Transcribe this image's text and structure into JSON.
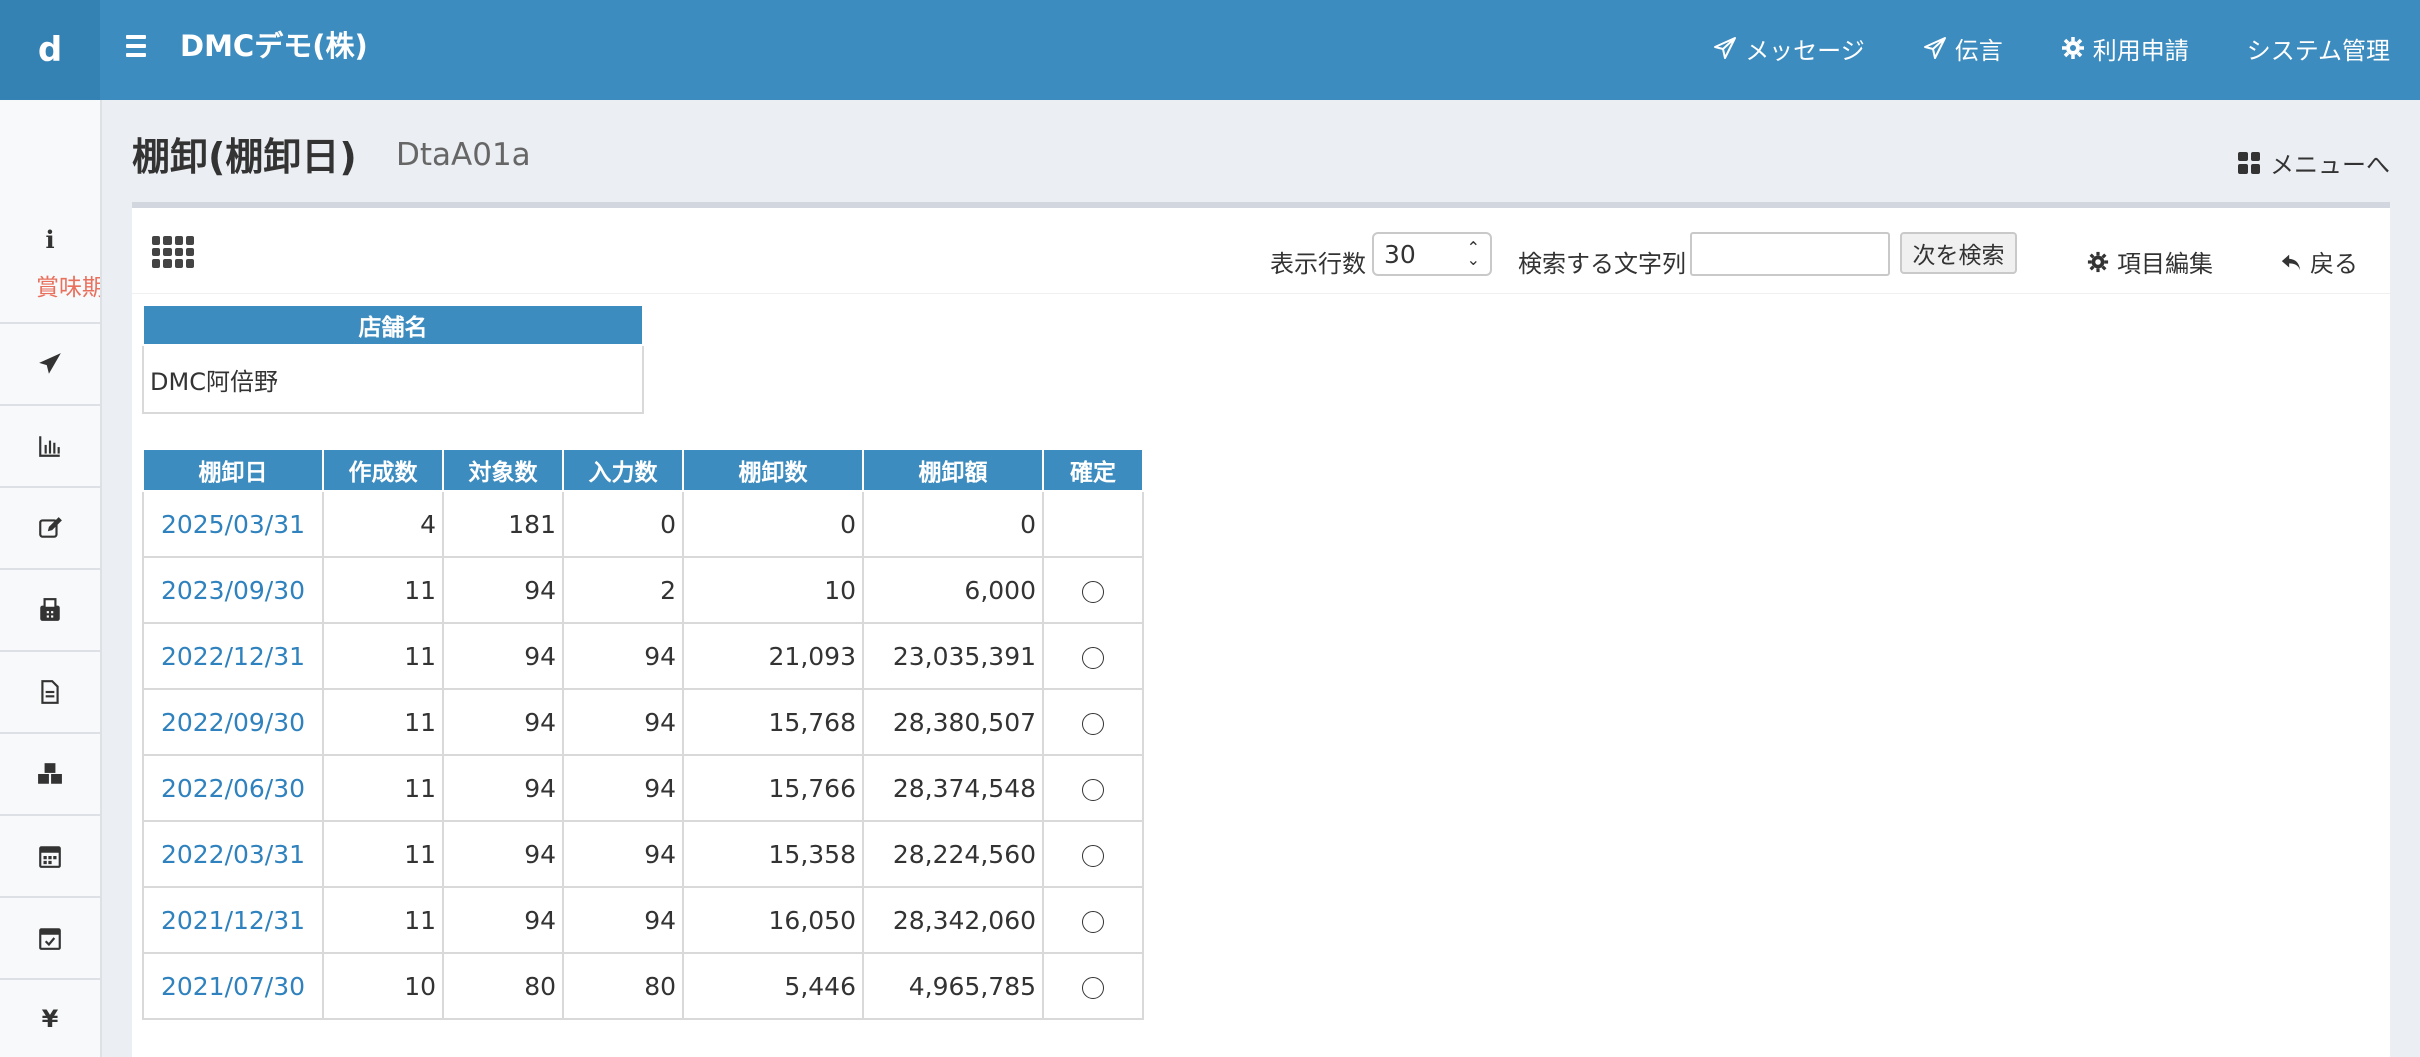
{
  "header": {
    "logo": "d",
    "company": "DMCデモ(株)",
    "nav": [
      {
        "label": "メッセージ",
        "icon": "paper-plane-icon"
      },
      {
        "label": "伝言",
        "icon": "paper-plane-icon"
      },
      {
        "label": "利用申請",
        "icon": "gear-icon"
      },
      {
        "label": "システム管理",
        "icon": ""
      }
    ]
  },
  "sidebar": {
    "info_glyph": "i",
    "notice": "賞味期",
    "items": [
      {
        "icon": "paper-plane-icon"
      },
      {
        "icon": "bar-chart-icon"
      },
      {
        "icon": "edit-icon"
      },
      {
        "icon": "fax-icon"
      },
      {
        "icon": "document-icon"
      },
      {
        "icon": "cubes-icon"
      },
      {
        "icon": "calendar-icon"
      },
      {
        "icon": "calendar-check-icon"
      },
      {
        "icon": "yen-icon",
        "glyph": "¥"
      }
    ]
  },
  "page": {
    "title": "棚卸(棚卸日)",
    "code": "DtaA01a",
    "menu_link": "メニューへ"
  },
  "toolbar": {
    "rows_label": "表示行数",
    "rows_value": "30",
    "search_label": "検索する文字列",
    "search_value": "",
    "next_button": "次を検索",
    "edit_items": "項目編集",
    "back": "戻る"
  },
  "store": {
    "header": "店舗名",
    "value": "DMC阿倍野"
  },
  "inventory": {
    "columns": [
      "棚卸日",
      "作成数",
      "対象数",
      "入力数",
      "棚卸数",
      "棚卸額",
      "確定"
    ],
    "rows": [
      {
        "date": "2025/03/31",
        "created": "4",
        "target": "181",
        "input": "0",
        "count": "0",
        "amount": "0",
        "confirmed": false
      },
      {
        "date": "2023/09/30",
        "created": "11",
        "target": "94",
        "input": "2",
        "count": "10",
        "amount": "6,000",
        "confirmed": true
      },
      {
        "date": "2022/12/31",
        "created": "11",
        "target": "94",
        "input": "94",
        "count": "21,093",
        "amount": "23,035,391",
        "confirmed": true
      },
      {
        "date": "2022/09/30",
        "created": "11",
        "target": "94",
        "input": "94",
        "count": "15,768",
        "amount": "28,380,507",
        "confirmed": true
      },
      {
        "date": "2022/06/30",
        "created": "11",
        "target": "94",
        "input": "94",
        "count": "15,766",
        "amount": "28,374,548",
        "confirmed": true
      },
      {
        "date": "2022/03/31",
        "created": "11",
        "target": "94",
        "input": "94",
        "count": "15,358",
        "amount": "28,224,560",
        "confirmed": true
      },
      {
        "date": "2021/12/31",
        "created": "11",
        "target": "94",
        "input": "94",
        "count": "16,050",
        "amount": "28,342,060",
        "confirmed": true
      },
      {
        "date": "2021/07/30",
        "created": "10",
        "target": "80",
        "input": "80",
        "count": "5,446",
        "amount": "4,965,785",
        "confirmed": true
      }
    ]
  },
  "colors": {
    "header_blue": "#3d8cbf",
    "link_blue": "#2f82bd",
    "notice_red": "#e8705d"
  }
}
